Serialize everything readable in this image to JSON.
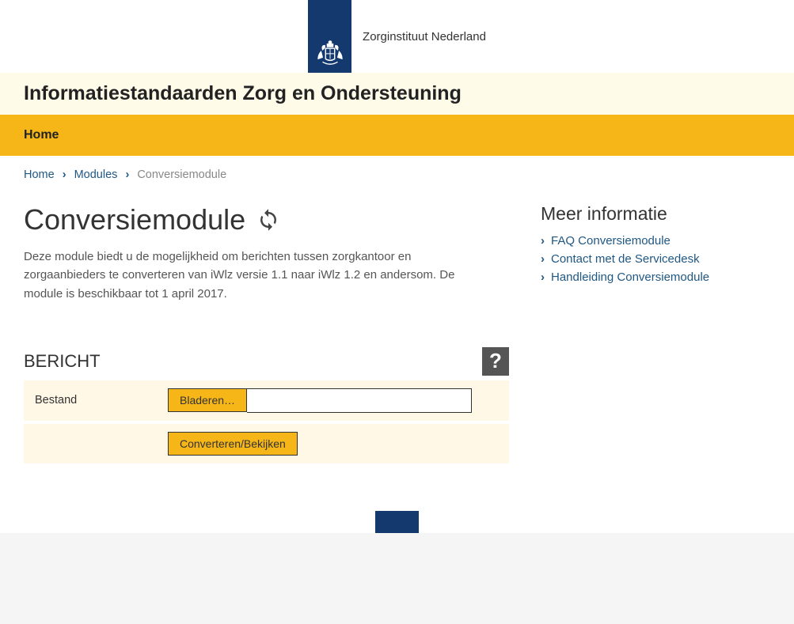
{
  "header": {
    "site_name": "Zorginstituut Nederland"
  },
  "title_bar": {
    "title": "Informatiestandaarden Zorg en Ondersteuning"
  },
  "nav": {
    "home": "Home"
  },
  "breadcrumb": {
    "home": "Home",
    "modules": "Modules",
    "current": "Conversiemodule"
  },
  "main": {
    "title": "Conversiemodule",
    "description": "Deze module biedt u de mogelijkheid om berichten tussen zorgkantoor en zorgaanbieders te converteren van iWlz versie 1.1 naar iWlz 1.2 en andersom. De module is beschikbaar tot 1 april 2017.",
    "section_title": "BERICHT",
    "help_label": "?",
    "form": {
      "file_label": "Bestand",
      "browse_label": "Bladeren…",
      "file_value": "",
      "convert_label": "Converteren/Bekijken"
    }
  },
  "sidebar": {
    "title": "Meer informatie",
    "links": [
      "FAQ Conversiemodule",
      "Contact met de Servicedesk",
      "Handleiding Conversiemodule"
    ]
  }
}
